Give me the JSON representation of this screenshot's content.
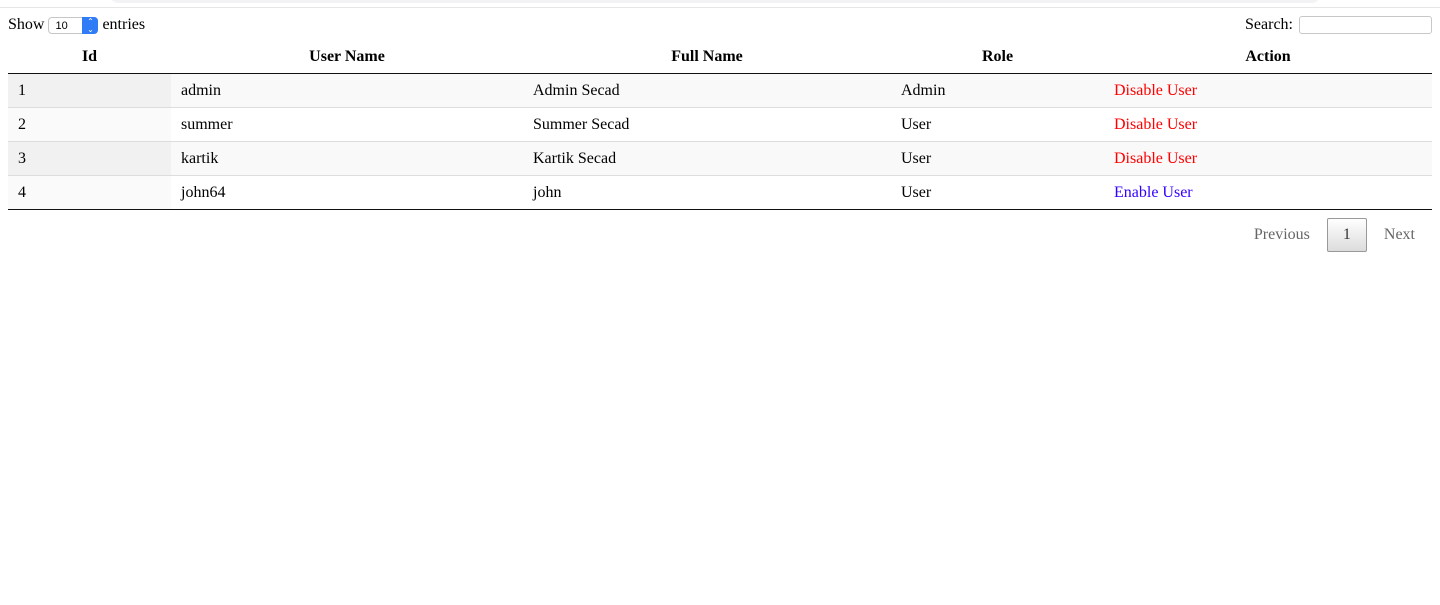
{
  "length": {
    "show": "Show",
    "value": "10",
    "entries": "entries"
  },
  "search": {
    "label": "Search:",
    "value": ""
  },
  "columns": [
    "Id",
    "User Name",
    "Full Name",
    "Role",
    "Action"
  ],
  "rows": [
    {
      "id": "1",
      "username": "admin",
      "fullname": "Admin Secad",
      "role": "Admin",
      "action": "Disable User",
      "action_color": "#ff0000"
    },
    {
      "id": "2",
      "username": "summer",
      "fullname": "Summer Secad",
      "role": "User",
      "action": "Disable User",
      "action_color": "#ff0000"
    },
    {
      "id": "3",
      "username": "kartik",
      "fullname": "Kartik Secad",
      "role": "User",
      "action": "Disable User",
      "action_color": "#ff0000"
    },
    {
      "id": "4",
      "username": "john64",
      "fullname": "john",
      "role": "User",
      "action": "Enable User",
      "action_color": "#3300ff"
    }
  ],
  "pagination": {
    "previous": "Previous",
    "current": "1",
    "next": "Next"
  }
}
